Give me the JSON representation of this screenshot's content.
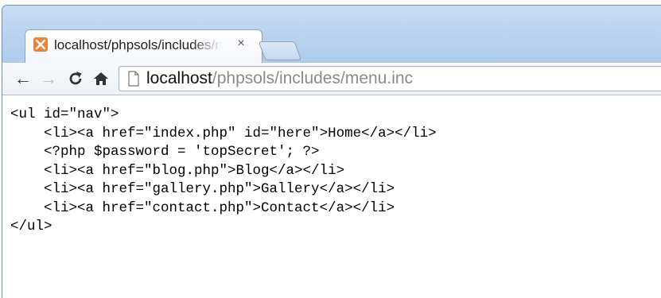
{
  "browser": {
    "tab": {
      "title": "localhost/phpsols/includes/menu.inc",
      "close_glyph": "×",
      "favicon": "xampp-icon"
    },
    "toolbar": {
      "back_glyph": "←",
      "forward_glyph": "→",
      "reload_icon": "reload-icon",
      "home_icon": "home-icon"
    },
    "address": {
      "host": "localhost",
      "path": "/phpsols/includes/menu.inc",
      "page_icon": "page-icon"
    }
  },
  "page": {
    "code_lines": [
      "<ul id=\"nav\">",
      "    <li><a href=\"index.php\" id=\"here\">Home</a></li>",
      "    <?php $password = 'topSecret'; ?>",
      "    <li><a href=\"blog.php\">Blog</a></li>",
      "    <li><a href=\"gallery.php\">Gallery</a></li>",
      "    <li><a href=\"contact.php\">Contact</a></li>",
      "</ul>"
    ]
  },
  "colors": {
    "tabstrip": "#aecbec",
    "favicon": "#e9823c",
    "url_path": "#8a8a8a"
  }
}
